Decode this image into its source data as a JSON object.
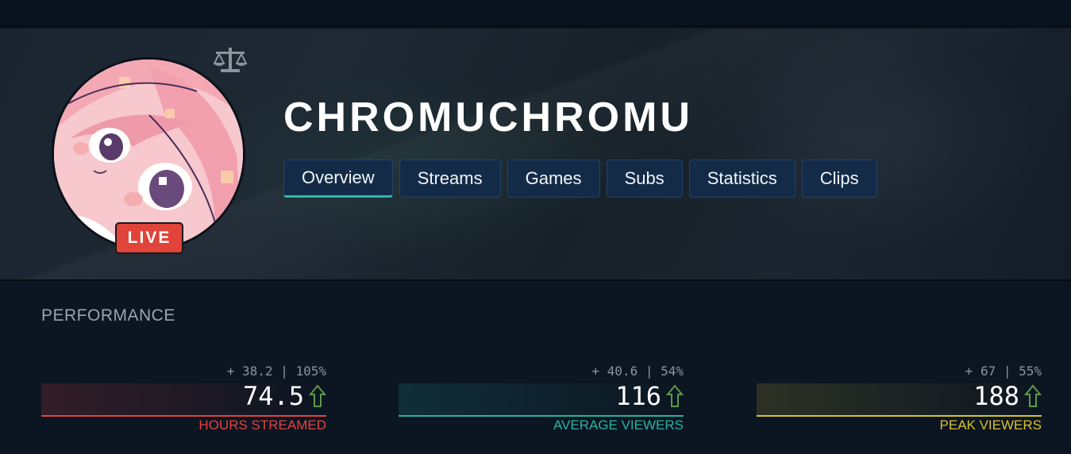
{
  "channel": {
    "name": "CHROMUCHROMU",
    "live_badge": "LIVE",
    "avatar_icon": "anime-avatar",
    "compare_icon": "scale-icon"
  },
  "tabs": [
    {
      "label": "Overview",
      "active": true
    },
    {
      "label": "Streams",
      "active": false
    },
    {
      "label": "Games",
      "active": false
    },
    {
      "label": "Subs",
      "active": false
    },
    {
      "label": "Statistics",
      "active": false
    },
    {
      "label": "Clips",
      "active": false
    }
  ],
  "performance": {
    "title": "PERFORMANCE",
    "stats": [
      {
        "delta": "+ 38.2 | 105%",
        "value": "74.5",
        "label": "HOURS STREAMED",
        "color": "#e2433e",
        "trend": "up"
      },
      {
        "delta": "+ 40.6 | 54%",
        "value": "116",
        "label": "AVERAGE VIEWERS",
        "color": "#27b39f",
        "trend": "up"
      },
      {
        "delta": "+ 67 | 55%",
        "value": "188",
        "label": "PEAK VIEWERS",
        "color": "#d7c22c",
        "trend": "up"
      }
    ]
  },
  "colors": {
    "accent": "#2fb8a6",
    "tab_bg": "#142b48",
    "live": "#e0443a",
    "trend_up": "#5b9a4b"
  }
}
